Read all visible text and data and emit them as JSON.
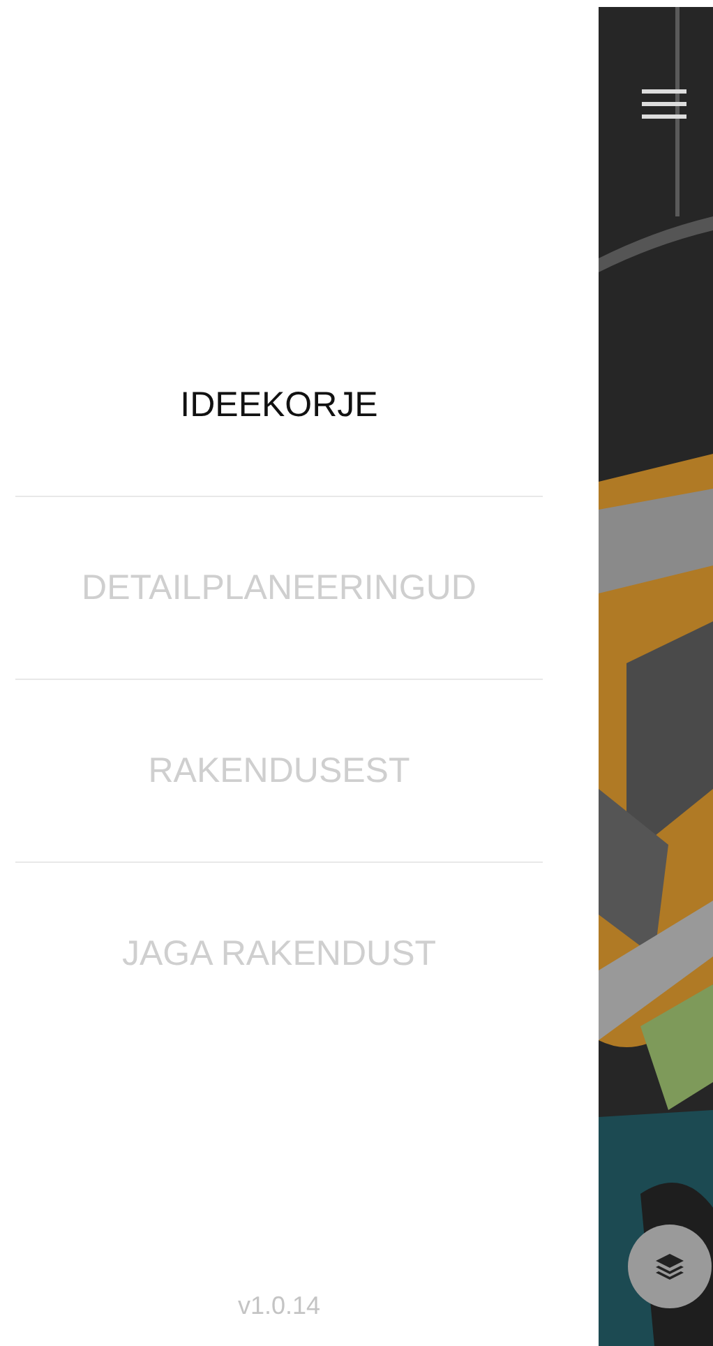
{
  "menu": {
    "items": [
      {
        "label": "IDEEKORJE",
        "selected": true
      },
      {
        "label": "DETAILPLANEERINGUD",
        "selected": false
      },
      {
        "label": "RAKENDUSEST",
        "selected": false
      },
      {
        "label": "JAGA RAKENDUST",
        "selected": false
      }
    ]
  },
  "version": "v1.0.14"
}
